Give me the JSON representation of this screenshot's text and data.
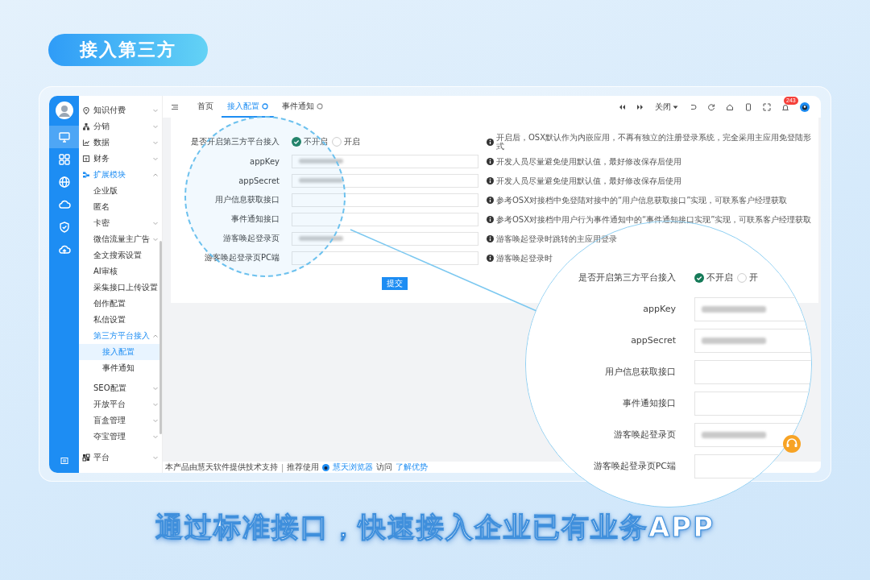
{
  "banner": {
    "title": "接入第三方"
  },
  "rail": {
    "items": [
      {
        "selected": true
      },
      {
        "selected": false
      },
      {
        "selected": false
      },
      {
        "selected": false
      },
      {
        "selected": false
      },
      {
        "selected": false
      }
    ]
  },
  "sidebar": {
    "items": [
      {
        "label": "知识付费",
        "expanded": false,
        "selected": false
      },
      {
        "label": "分销",
        "expanded": false,
        "selected": false
      },
      {
        "label": "数据",
        "expanded": false,
        "selected": false
      },
      {
        "label": "财务",
        "expanded": false,
        "selected": false
      },
      {
        "label": "扩展模块",
        "expanded": true,
        "selected": false,
        "children": [
          {
            "label": "企业版",
            "selected": false
          },
          {
            "label": "匿名",
            "selected": false
          },
          {
            "label": "卡密",
            "expanded": false,
            "selected": false
          },
          {
            "label": "微信流量主广告",
            "expanded": false,
            "selected": false
          },
          {
            "label": "全文搜索设置",
            "selected": false
          },
          {
            "label": "AI审核",
            "selected": false
          },
          {
            "label": "采集接口上传设置",
            "selected": false
          },
          {
            "label": "创作配置",
            "selected": false
          },
          {
            "label": "私信设置",
            "selected": false
          },
          {
            "label": "第三方平台接入",
            "expanded": true,
            "selected": false,
            "children": [
              {
                "label": "接入配置",
                "selected": true
              },
              {
                "label": "事件通知",
                "selected": false
              }
            ]
          },
          {
            "label": "SEO配置",
            "expanded": false,
            "selected": false
          },
          {
            "label": "开放平台",
            "expanded": false,
            "selected": false
          },
          {
            "label": "盲盒管理",
            "expanded": false,
            "selected": false
          },
          {
            "label": "夺宝管理",
            "expanded": false,
            "selected": false
          }
        ]
      },
      {
        "label": "平台",
        "expanded": false,
        "selected": false
      }
    ]
  },
  "tabs": [
    {
      "label": "首页",
      "selected": false,
      "closable": false
    },
    {
      "label": "接入配置",
      "selected": true,
      "closable": true
    },
    {
      "label": "事件通知",
      "selected": false,
      "closable": true
    }
  ],
  "toolbar": {
    "close_menu": "关闭",
    "notification_badge": "243"
  },
  "form": {
    "fields": [
      {
        "label": "是否开启第三方平台接入",
        "kind": "radio",
        "options": [
          {
            "label": "不开启",
            "selected": true
          },
          {
            "label": "开启",
            "selected": false
          }
        ]
      },
      {
        "label": "appKey",
        "kind": "text",
        "blurred": true
      },
      {
        "label": "appSecret",
        "kind": "text",
        "blurred": true
      },
      {
        "label": "用户信息获取接口",
        "kind": "text",
        "blurred": false
      },
      {
        "label": "事件通知接口",
        "kind": "text",
        "blurred": false
      },
      {
        "label": "游客唤起登录页",
        "kind": "text",
        "blurred": true
      },
      {
        "label": "游客唤起登录页PC端",
        "kind": "text",
        "blurred": false
      }
    ],
    "notes": [
      "开启后，OSX默认作为内嵌应用，不再有独立的注册登录系统，完全采用主应用免登陆形式",
      "开发人员尽量避免使用默认值，最好修改保存后使用",
      "开发人员尽量避免使用默认值，最好修改保存后使用",
      "参考OSX对接档中免登陆对接中的“用户信息获取接口”实现，可联系客户经理获取",
      "参考OSX对接档中用户行为事件通知中的“事件通知接口实现”实现，可联系客户经理获取",
      "游客唤起登录时跳转的主应用登录",
      "游客唤起登录时"
    ],
    "submit": "提交"
  },
  "footer": {
    "support": "本产品由慧天软件提供技术支持",
    "separator": "|",
    "recommend": "推荐使用",
    "browser_link": "慧天浏览器",
    "visit": "访问",
    "learn_more_link": "了解优势"
  },
  "magnifier": {
    "fields": [
      {
        "label": "是否开启第三方平台接入",
        "kind": "radio",
        "options": [
          {
            "label": "不开启",
            "selected": true
          },
          {
            "label": "开",
            "selected": false
          }
        ]
      },
      {
        "label": "appKey",
        "kind": "text",
        "blurred": true
      },
      {
        "label": "appSecret",
        "kind": "text",
        "blurred": true
      },
      {
        "label": "用户信息获取接口",
        "kind": "text",
        "blurred": false
      },
      {
        "label": "事件通知接口",
        "kind": "text",
        "blurred": false
      },
      {
        "label": "游客唤起登录页",
        "kind": "text",
        "blurred": true
      },
      {
        "label": "游客唤起登录页PC端",
        "kind": "text",
        "blurred": false
      }
    ]
  },
  "headline": "通过标准接口，快速接入企业已有业务APP"
}
